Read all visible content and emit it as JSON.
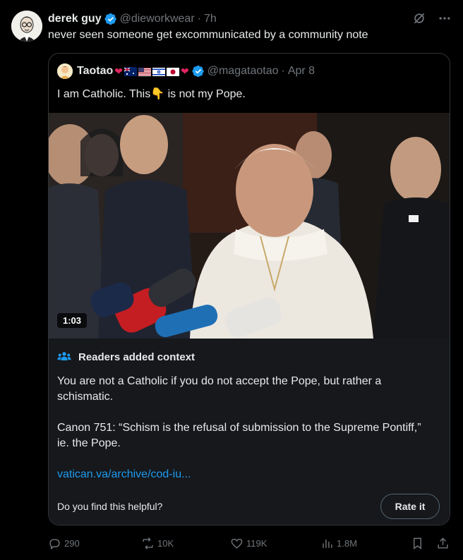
{
  "tweet": {
    "author_name": "derek guy",
    "handle": "@dieworkwear",
    "separator": "·",
    "time": "7h",
    "text": "never seen someone get excommunicated by a community note"
  },
  "quote": {
    "author_name": "Taotao",
    "handle": "@magataotao",
    "separator": "·",
    "time": "Apr 8",
    "text": "I am Catholic. This👇 is not my Pope.",
    "video_duration": "1:03"
  },
  "community_note": {
    "title": "Readers added context",
    "paragraph_1": "You are not a Catholic if you do not accept the Pope, but rather a schismatic.",
    "paragraph_2": "Canon 751: “Schism is the refusal of submission to the Supreme Pontiff,” ie. the Pope.",
    "link": "vatican.va/archive/cod-iu...",
    "helpful_prompt": "Do you find this helpful?",
    "rate_button": "Rate it"
  },
  "actions": {
    "replies": "290",
    "reposts": "10K",
    "likes": "119K",
    "views": "1.8M"
  },
  "colors": {
    "background": "#000000",
    "text_primary": "#e7e9ea",
    "text_secondary": "#71767b",
    "link": "#1d9bf0",
    "verified": "#1d9bf0",
    "note_background": "#16181c",
    "border": "#2f3336"
  },
  "icons": [
    "verified-badge-icon",
    "grok-icon",
    "more-icon",
    "people-icon",
    "reply-icon",
    "repost-icon",
    "like-icon",
    "views-icon",
    "bookmark-icon",
    "share-icon"
  ]
}
